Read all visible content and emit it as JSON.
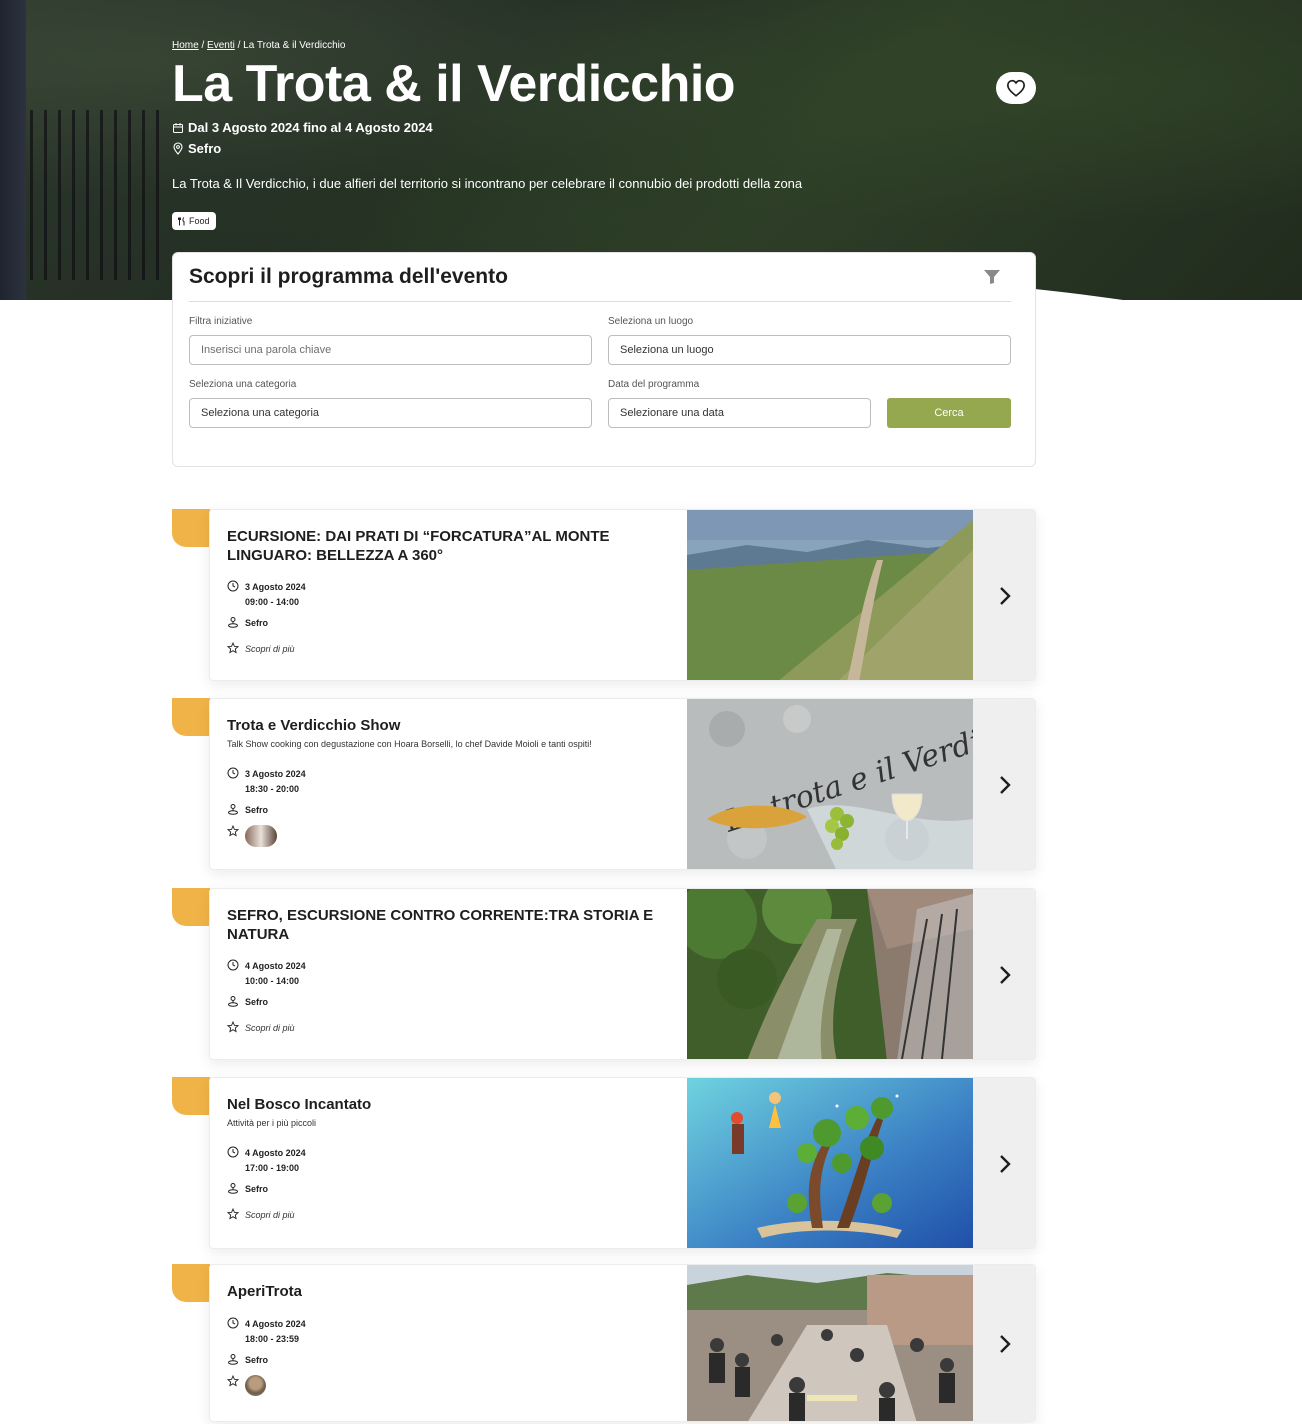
{
  "breadcrumb": {
    "home": "Home",
    "events": "Eventi",
    "current": "La Trota & il Verdicchio",
    "sep": "/"
  },
  "hero": {
    "title": "La Trota & il Verdicchio",
    "dates": "Dal 3 Agosto 2024 fino al 4 Agosto 2024",
    "place": "Sefro",
    "description": "La Trota & Il Verdicchio, i due alfieri del territorio si incontrano per celebrare il connubio dei prodotti della zona",
    "tag": "Food",
    "fav_icon": "heart-icon"
  },
  "filter": {
    "title": "Scopri il programma dell'evento",
    "keyword_label": "Filtra iniziative",
    "keyword_placeholder": "Inserisci una parola chiave",
    "place_label": "Seleziona un luogo",
    "place_value": "Seleziona un luogo",
    "category_label": "Seleziona una categoria",
    "category_value": "Seleziona una categoria",
    "date_label": "Data del programma",
    "date_value": "Selezionare una data",
    "search_label": "Cerca"
  },
  "events": [
    {
      "title": "ECURSIONE: DAI PRATI DI “FORCATURA”AL MONTE LINGUARO: BELLEZZA A 360°",
      "subtitle": "",
      "date": "3 Agosto 2024",
      "time": "09:00 - 14:00",
      "place": "Sefro",
      "more": "Scopri di più",
      "image": "mountain-trail-photo"
    },
    {
      "title": "Trota e Verdicchio Show",
      "subtitle": "Talk Show cooking con degustazione con Hoara Borselli, lo chef Davide Moioli e tanti ospiti!",
      "date": "3 Agosto 2024",
      "time": "18:30 - 20:00",
      "place": "Sefro",
      "more": "",
      "image": "trota-verdicchio-illustration",
      "image_text": "La trota e il Verdicchio"
    },
    {
      "title": "SEFRO, ESCURSIONE CONTRO CORRENTE:TRA STORIA E NATURA",
      "subtitle": "",
      "date": "4 Agosto 2024",
      "time": "10:00 - 14:00",
      "place": "Sefro",
      "more": "Scopri di più",
      "image": "stream-photo"
    },
    {
      "title": "Nel Bosco Incantato",
      "subtitle": "Attività per i più piccoli",
      "date": "4 Agosto 2024",
      "time": "17:00 - 19:00",
      "place": "Sefro",
      "more": "Scopri di più",
      "image": "enchanted-forest-illustration"
    },
    {
      "title": "AperiTrota",
      "subtitle": "",
      "date": "4 Agosto 2024",
      "time": "18:00 - 23:59",
      "place": "Sefro",
      "more": "",
      "image": "village-square-photo"
    }
  ],
  "colors": {
    "accent_tab": "#f0b347",
    "search_button": "#95a84f",
    "arrow_bg": "#efefef"
  }
}
